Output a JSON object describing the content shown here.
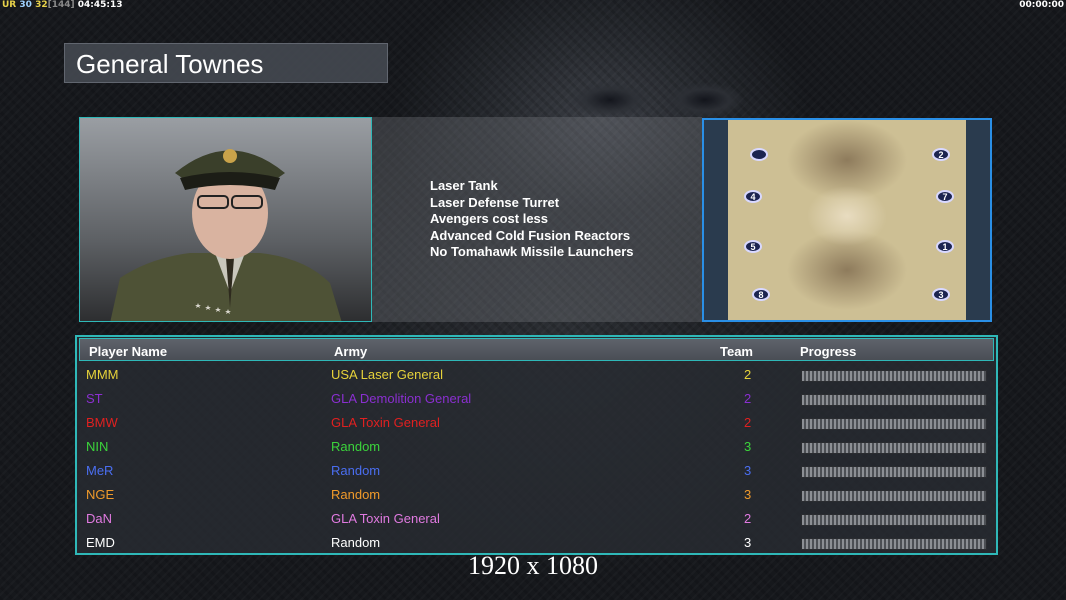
{
  "topbar": {
    "tag": "UR",
    "fps": "30",
    "fps_cap": "32",
    "frames": "[144]",
    "time": "04:45:13",
    "right_time": "00:00:00"
  },
  "general": {
    "name": "General Townes"
  },
  "features": [
    "Laser Tank",
    "Laser Defense Turret",
    "Avengers cost less",
    "Advanced Cold Fusion Reactors",
    "No Tomahawk Missile Launchers"
  ],
  "map": {
    "spawns": [
      "2",
      "4",
      "7",
      "5",
      "1",
      "8",
      "3"
    ]
  },
  "table": {
    "headers": {
      "player": "Player Name",
      "army": "Army",
      "team": "Team",
      "progress": "Progress"
    },
    "rows": [
      {
        "player": "MMM",
        "army": "USA Laser General",
        "team": "2",
        "color": "#e6d23a"
      },
      {
        "player": "ST",
        "army": "GLA Demolition General",
        "team": "2",
        "color": "#8a2fd0"
      },
      {
        "player": "BMW",
        "army": "GLA Toxin General",
        "team": "2",
        "color": "#e02020"
      },
      {
        "player": "NIN",
        "army": "Random",
        "team": "3",
        "color": "#3bd43b"
      },
      {
        "player": "MeR",
        "army": "Random",
        "team": "3",
        "color": "#4a6ef0"
      },
      {
        "player": "NGE",
        "army": "Random",
        "team": "3",
        "color": "#f09a2a"
      },
      {
        "player": "DaN",
        "army": "GLA Toxin General",
        "team": "2",
        "color": "#e07ae0"
      },
      {
        "player": "EMD",
        "army": "Random",
        "team": "3",
        "color": "#ffffff"
      }
    ]
  },
  "resolution": "1920 x 1080"
}
